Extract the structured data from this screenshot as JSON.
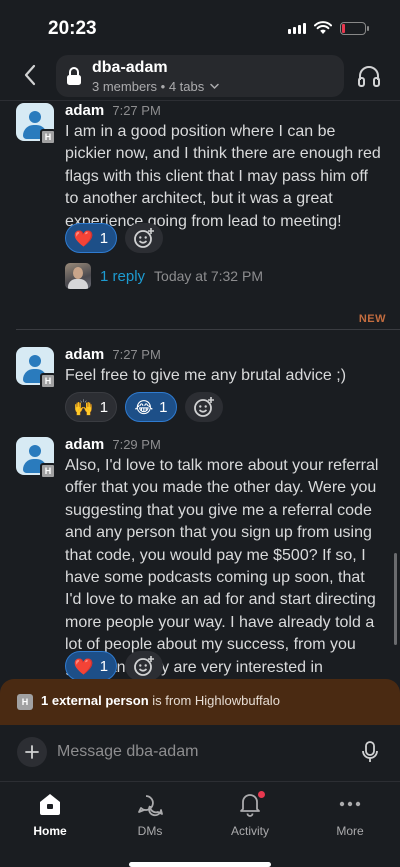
{
  "status_bar": {
    "time": "20:23"
  },
  "header": {
    "channel_name": "dba-adam",
    "members_label": "3 members",
    "tabs_label": "4 tabs"
  },
  "messages": [
    {
      "author": "adam",
      "time": "7:27 PM",
      "badge": "H",
      "text": "I am in a good position where I can be pickier now, and I think there are enough red flags with this client that I may pass him off to another architect, but it was a great experience going from lead to meeting!",
      "reactions": [
        {
          "emoji": "❤️",
          "count": "1",
          "active": true
        }
      ],
      "thread": {
        "reply_label": "1 reply",
        "reply_time": "Today at 7:32 PM"
      }
    },
    {
      "author": "adam",
      "time": "7:27 PM",
      "badge": "H",
      "text": "Feel free to give me any brutal advice ;)",
      "reactions": [
        {
          "emoji": "🙌",
          "count": "1",
          "active": false
        },
        {
          "emoji": "😂",
          "count": "1",
          "active": true
        }
      ]
    },
    {
      "author": "adam",
      "time": "7:29 PM",
      "badge": "H",
      "text": "Also, I'd love to talk more about your referral offer that you made the other day.  Were you suggesting that you give me a referral code and any person that you sign up from using that code, you would pay me $500? If so, I have some podcasts coming up soon, that I'd love to make an ad for and start directing more people your way. I have already told a lot of people about my success, from you guys, and they are very interested in learning more!",
      "reactions": [
        {
          "emoji": "❤️",
          "count": "1",
          "active": true
        }
      ]
    }
  ],
  "new_divider_label": "NEW",
  "external_banner": {
    "badge": "H",
    "bold": "1 external person",
    "rest": " is from Highlowbuffalo"
  },
  "composer": {
    "placeholder": "Message dba-adam"
  },
  "tabs": [
    {
      "label": "Home",
      "icon": "home-icon",
      "active": true
    },
    {
      "label": "DMs",
      "icon": "dms-icon",
      "active": false
    },
    {
      "label": "Activity",
      "icon": "bell-icon",
      "active": false,
      "has_dot": true
    },
    {
      "label": "More",
      "icon": "more-icon",
      "active": false
    }
  ],
  "colors": {
    "background": "#1a1d21",
    "link": "#1d9bd1",
    "new_label": "#c26c3f",
    "reaction_active": "#1d4f88",
    "banner": "#4a2a12",
    "notification_dot": "#e8384f"
  }
}
